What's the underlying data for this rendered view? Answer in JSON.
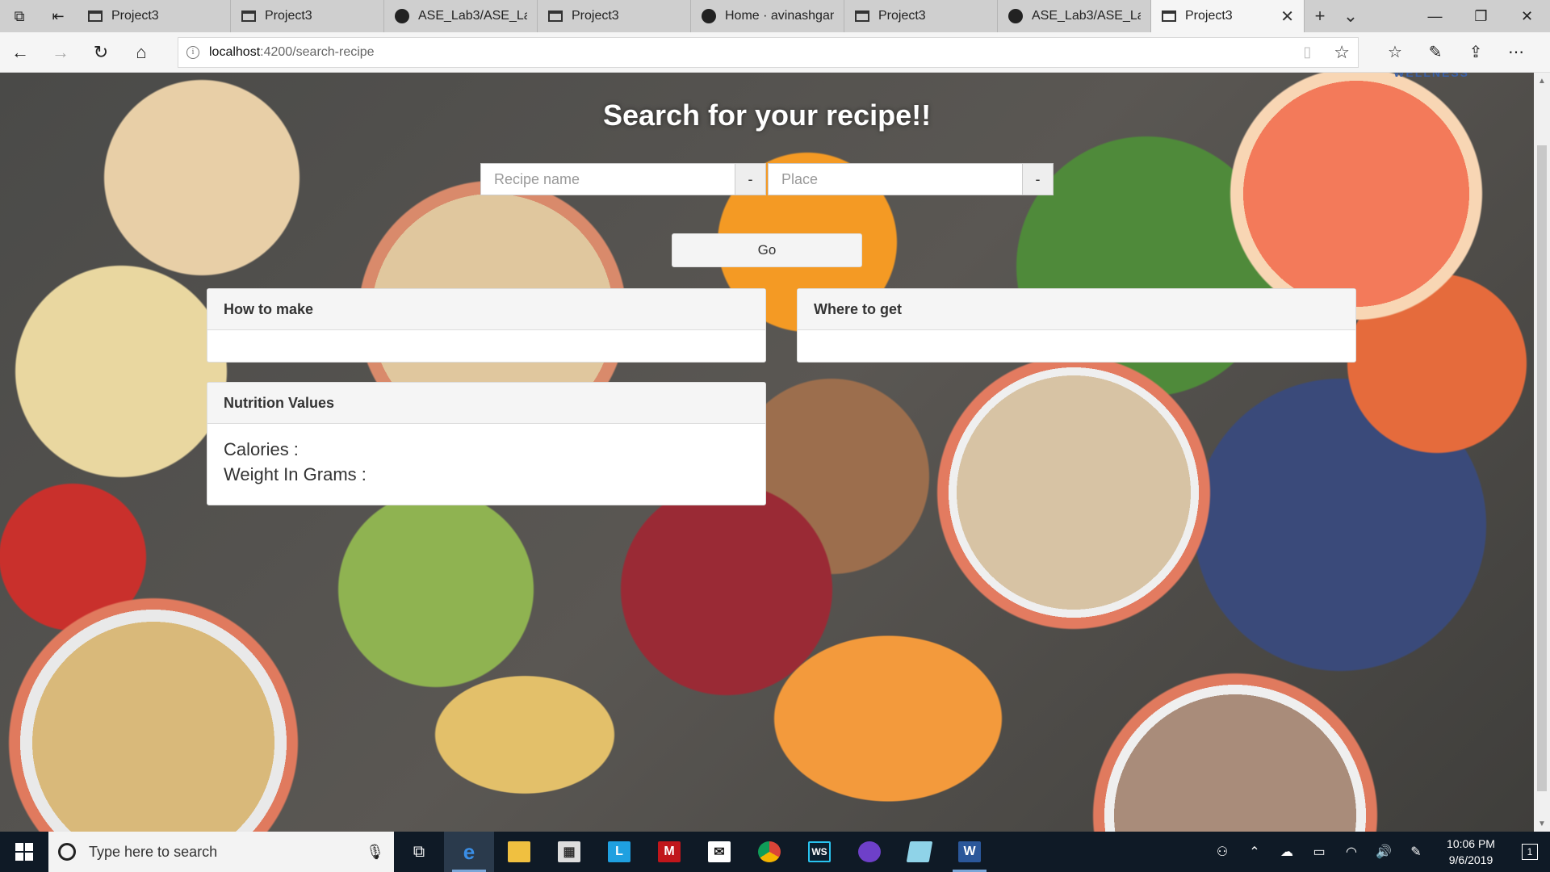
{
  "browser": {
    "tabs": [
      {
        "label": "Project3",
        "icon": "page-icon"
      },
      {
        "label": "Project3",
        "icon": "page-icon"
      },
      {
        "label": "ASE_Lab3/ASE_Lab3",
        "icon": "github-icon"
      },
      {
        "label": "Project3",
        "icon": "page-icon"
      },
      {
        "label": "Home · avinashgan",
        "icon": "github-icon"
      },
      {
        "label": "Project3",
        "icon": "page-icon"
      },
      {
        "label": "ASE_Lab3/ASE_Lab3",
        "icon": "github-icon"
      },
      {
        "label": "Project3",
        "icon": "page-icon",
        "active": true
      }
    ],
    "url_host": "localhost",
    "url_path": ":4200/search-recipe"
  },
  "page": {
    "title": "Search for your recipe!!",
    "corner_brand": "WELLNESS",
    "recipe_placeholder": "Recipe name",
    "recipe_addon": "-",
    "place_placeholder": "Place",
    "place_addon": "-",
    "go_label": "Go",
    "panels": {
      "how_to_make": "How to make",
      "where_to_get": "Where to get",
      "nutrition": "Nutrition Values"
    },
    "nutrition": {
      "calories_label": "Calories :",
      "weight_label": "Weight In Grams :"
    }
  },
  "taskbar": {
    "search_placeholder": "Type here to search",
    "time": "10:06 PM",
    "date": "9/6/2019",
    "notification_count": "1"
  },
  "colors": {
    "title_text": "#ffffff",
    "taskbar_bg": "#0f1a26",
    "panel_header_bg": "#f5f5f5",
    "brand_blue": "#3a60a8"
  }
}
